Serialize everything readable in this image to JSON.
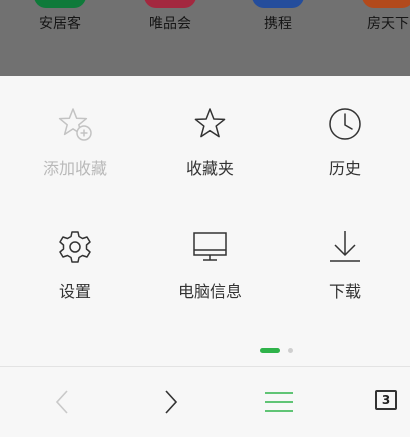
{
  "shortcuts": [
    {
      "label": "安居客",
      "color": "#0f7a3a"
    },
    {
      "label": "唯品会",
      "color": "#a3283f"
    },
    {
      "label": "携程",
      "color": "#244d9c"
    },
    {
      "label": "房天下",
      "color": "#b24a1c"
    }
  ],
  "menu": {
    "items": [
      {
        "label": "添加收藏",
        "icon": "star-plus-icon",
        "enabled": false
      },
      {
        "label": "收藏夹",
        "icon": "star-icon",
        "enabled": true
      },
      {
        "label": "历史",
        "icon": "clock-icon",
        "enabled": true
      },
      {
        "label": "设置",
        "icon": "gear-icon",
        "enabled": true
      },
      {
        "label": "电脑信息",
        "icon": "monitor-icon",
        "enabled": true
      },
      {
        "label": "下载",
        "icon": "download-icon",
        "enabled": true
      }
    ],
    "page": {
      "current": 1,
      "total": 2
    }
  },
  "bottom_bar": {
    "tab_count": "3",
    "accent_color": "#2fb34a"
  }
}
